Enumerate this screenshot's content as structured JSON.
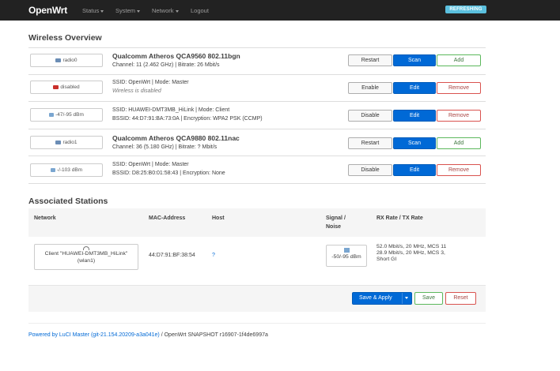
{
  "navbar": {
    "brand": "OpenWrt",
    "items": [
      "Status",
      "System",
      "Network",
      "Logout"
    ],
    "refresh_badge": "REFRESHING"
  },
  "wireless_overview": {
    "title": "Wireless Overview",
    "rows": [
      {
        "chip": "radio0",
        "title": "Qualcomm Atheros QCA9560 802.11bgn",
        "sub": "Channel: 11 (2.462 GHz) | Bitrate: 26 Mbit/s",
        "buttons": [
          "Restart",
          "Scan",
          "Add"
        ]
      },
      {
        "chip": "disabled",
        "title": "SSID: OpenWrt | Mode: Master",
        "sub": "Wireless is disabled",
        "buttons": [
          "Enable",
          "Edit",
          "Remove"
        ]
      },
      {
        "chip": "-47/-95 dBm",
        "title": "SSID: HUAWEI-DMT3MB_HiLink | Mode: Client",
        "sub": "BSSID: 44:D7:91:BA:73:0A | Encryption: WPA2 PSK (CCMP)",
        "buttons": [
          "Disable",
          "Edit",
          "Remove"
        ]
      },
      {
        "chip": "radio1",
        "title": "Qualcomm Atheros QCA9880 802.11nac",
        "sub": "Channel: 36 (5.180 GHz) | Bitrate: ? Mbit/s",
        "buttons": [
          "Restart",
          "Scan",
          "Add"
        ]
      },
      {
        "chip": "-/-103 dBm",
        "title": "SSID: OpenWrt | Mode: Master",
        "sub": "BSSID: D8:25:B0:01:58:43 | Encryption: None",
        "buttons": [
          "Disable",
          "Edit",
          "Remove"
        ]
      }
    ]
  },
  "associated_stations": {
    "title": "Associated Stations",
    "headers": {
      "network": "Network",
      "mac": "MAC-Address",
      "host": "Host",
      "signal": "Signal /",
      "noise": "Noise",
      "rate": "RX Rate / TX Rate"
    },
    "station": {
      "network_line1": "Client \"HUAWEI-DMT3MB_HiLink\"",
      "network_line2": "(wlan1)",
      "mac": "44:D7:91:BF:38:54",
      "host": "?",
      "signal": "-50/-95 dBm",
      "rate_lines": [
        "52.0 Mbit/s, 20 MHz, MCS 11",
        "28.9 Mbit/s, 20 MHz, MCS 3,",
        "Short GI"
      ]
    }
  },
  "actions": {
    "save_apply": "Save & Apply",
    "save": "Save",
    "reset": "Reset"
  },
  "footer": {
    "link": "Powered by LuCI Master (git-21.154.20209-a3a041e)",
    "rest": " / OpenWrt SNAPSHOT r16907-1f4de6997a"
  }
}
